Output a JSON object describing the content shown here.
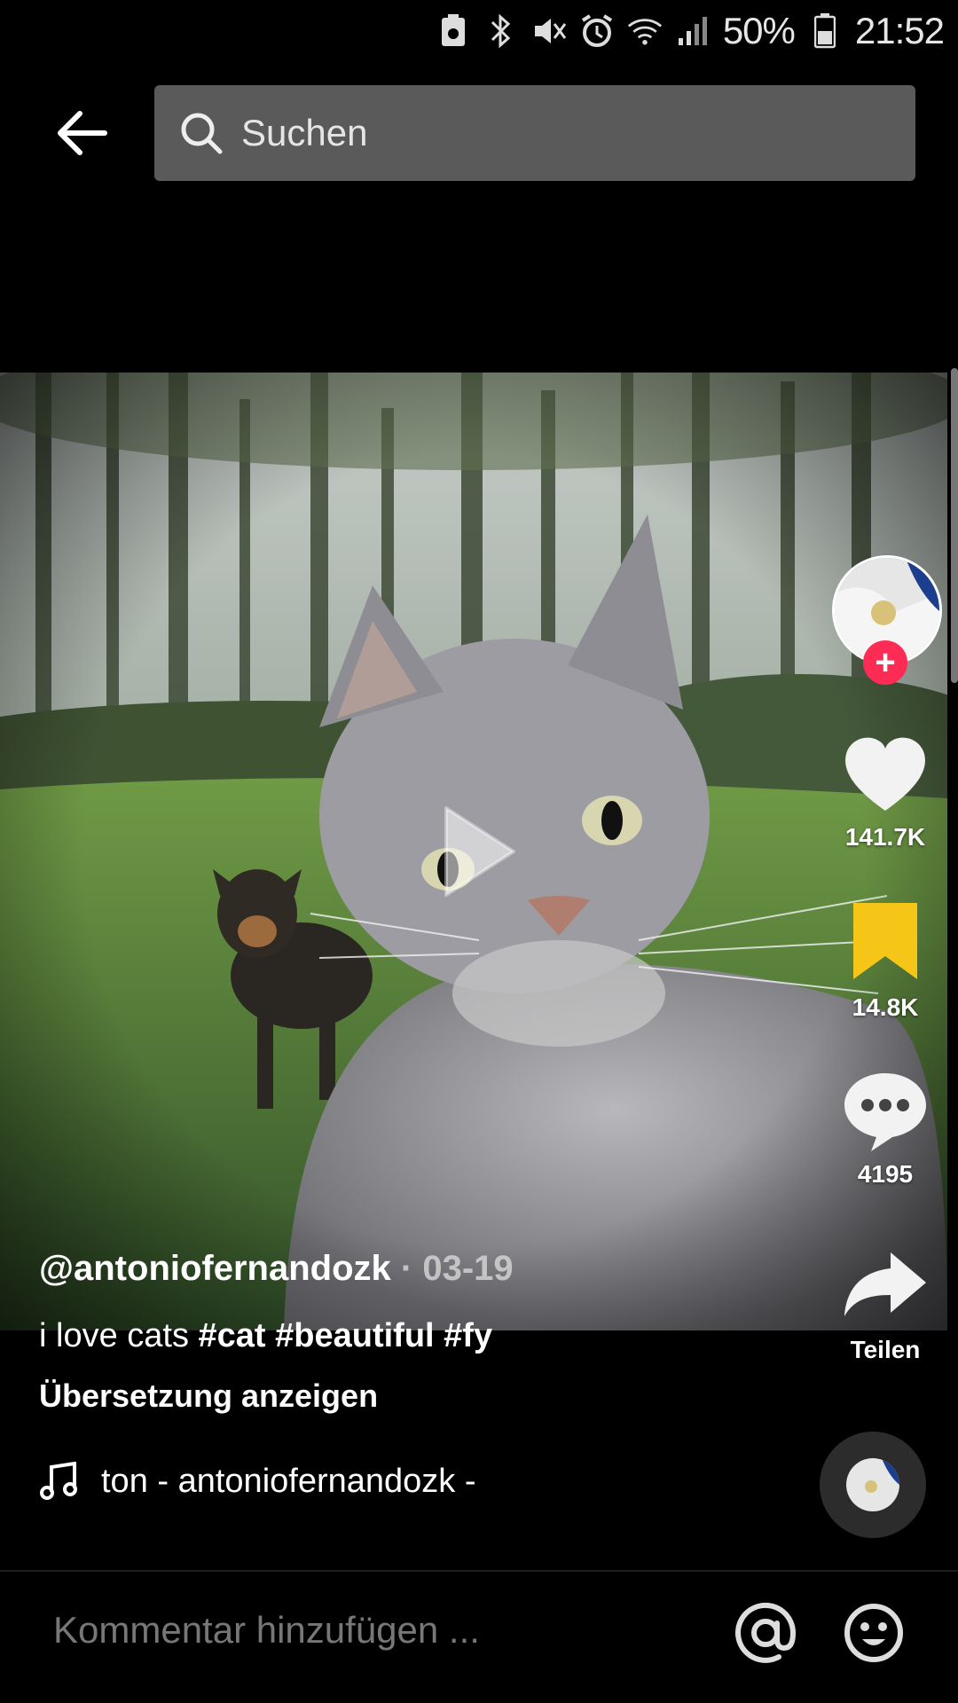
{
  "status_bar": {
    "icons": [
      "storage-icon",
      "bluetooth-icon",
      "mute-icon",
      "alarm-icon",
      "wifi-icon",
      "signal-icon",
      "battery-icon"
    ],
    "battery_percent": "50%",
    "time": "21:52"
  },
  "header": {
    "back_icon": "arrow-left-icon",
    "search_placeholder": "Suchen"
  },
  "video": {
    "subject": "cat selfie with dog in forest clearing",
    "play_icon": "play-icon"
  },
  "actions": {
    "likes": "141.7K",
    "favorites": "14.8K",
    "comments": "4195",
    "share_label": "Teilen",
    "colors": {
      "follow": "#fe2c55",
      "favorite": "#f5c518"
    }
  },
  "post": {
    "username": "@antoniofernandozk",
    "separator": "·",
    "date": "03-19",
    "caption_text": "i love cats",
    "hashtags": "#cat #beautiful #fy",
    "translate_label": "Übersetzung anzeigen",
    "sound": "ton - antoniofernandozk -"
  },
  "comment_bar": {
    "placeholder": "Kommentar hinzufügen ...",
    "mention_icon": "at-icon",
    "emoji_icon": "emoji-icon"
  }
}
